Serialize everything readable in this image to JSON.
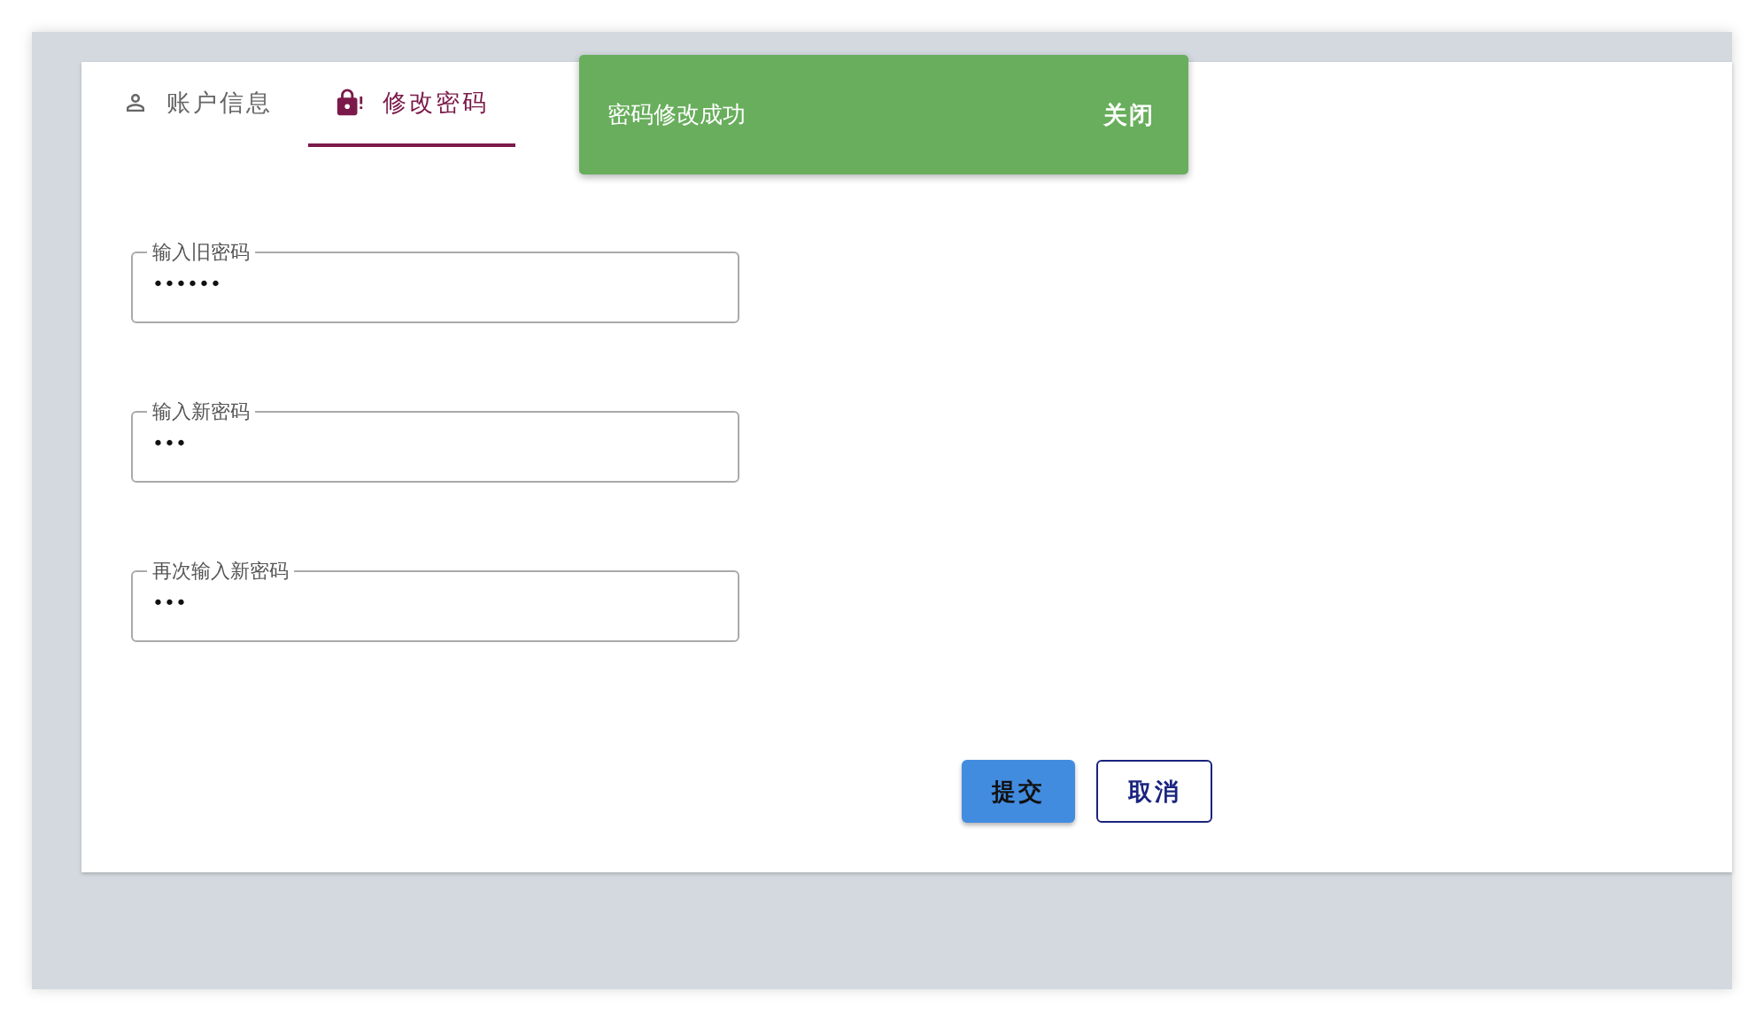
{
  "tabs": [
    {
      "label": "账户信息",
      "selected": false
    },
    {
      "label": "修改密码",
      "selected": true
    }
  ],
  "fields": [
    {
      "label": "输入旧密码",
      "value": "••••••"
    },
    {
      "label": "输入新密码",
      "value": "•••"
    },
    {
      "label": "再次输入新密码",
      "value": "•••"
    }
  ],
  "buttons": [
    {
      "label": "提交",
      "kind": "primary"
    },
    {
      "label": "取消",
      "kind": "outlined"
    }
  ],
  "snackbar": {
    "message": "密码修改成功",
    "action": "关闭"
  }
}
